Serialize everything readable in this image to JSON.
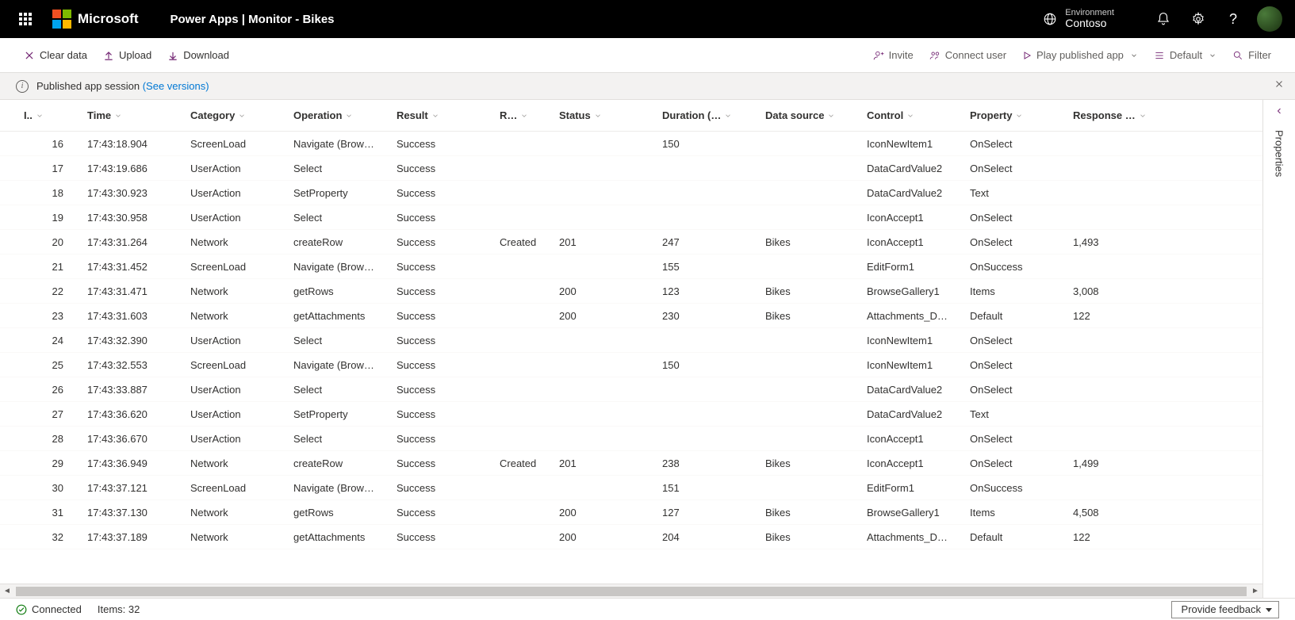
{
  "topbar": {
    "microsoft": "Microsoft",
    "app_title": "Power Apps  |  Monitor - Bikes",
    "env_label": "Environment",
    "env_name": "Contoso"
  },
  "cmdbar": {
    "clear": "Clear data",
    "upload": "Upload",
    "download": "Download",
    "invite": "Invite",
    "connect": "Connect user",
    "play": "Play published app",
    "default": "Default",
    "filter": "Filter"
  },
  "infobar": {
    "text": "Published app session",
    "link": "(See versions)"
  },
  "table": {
    "columns": {
      "id": "I..",
      "time": "Time",
      "category": "Category",
      "operation": "Operation",
      "result": "Result",
      "rstatus": "R…",
      "status": "Status",
      "duration": "Duration (…",
      "datasource": "Data source",
      "control": "Control",
      "property": "Property",
      "response": "Response …"
    },
    "rows": [
      {
        "id": "16",
        "time": "17:43:18.904",
        "category": "ScreenLoad",
        "operation": "Navigate (Brow…",
        "result": "Success",
        "rstatus": "",
        "status": "",
        "duration": "150",
        "datasource": "",
        "control": "IconNewItem1",
        "property": "OnSelect",
        "response": ""
      },
      {
        "id": "17",
        "time": "17:43:19.686",
        "category": "UserAction",
        "operation": "Select",
        "result": "Success",
        "rstatus": "",
        "status": "",
        "duration": "",
        "datasource": "",
        "control": "DataCardValue2",
        "property": "OnSelect",
        "response": ""
      },
      {
        "id": "18",
        "time": "17:43:30.923",
        "category": "UserAction",
        "operation": "SetProperty",
        "result": "Success",
        "rstatus": "",
        "status": "",
        "duration": "",
        "datasource": "",
        "control": "DataCardValue2",
        "property": "Text",
        "response": ""
      },
      {
        "id": "19",
        "time": "17:43:30.958",
        "category": "UserAction",
        "operation": "Select",
        "result": "Success",
        "rstatus": "",
        "status": "",
        "duration": "",
        "datasource": "",
        "control": "IconAccept1",
        "property": "OnSelect",
        "response": ""
      },
      {
        "id": "20",
        "time": "17:43:31.264",
        "category": "Network",
        "operation": "createRow",
        "result": "Success",
        "rstatus": "Created",
        "status": "201",
        "duration": "247",
        "datasource": "Bikes",
        "control": "IconAccept1",
        "property": "OnSelect",
        "response": "1,493"
      },
      {
        "id": "21",
        "time": "17:43:31.452",
        "category": "ScreenLoad",
        "operation": "Navigate (Brow…",
        "result": "Success",
        "rstatus": "",
        "status": "",
        "duration": "155",
        "datasource": "",
        "control": "EditForm1",
        "property": "OnSuccess",
        "response": ""
      },
      {
        "id": "22",
        "time": "17:43:31.471",
        "category": "Network",
        "operation": "getRows",
        "result": "Success",
        "rstatus": "",
        "status": "200",
        "duration": "123",
        "datasource": "Bikes",
        "control": "BrowseGallery1",
        "property": "Items",
        "response": "3,008"
      },
      {
        "id": "23",
        "time": "17:43:31.603",
        "category": "Network",
        "operation": "getAttachments",
        "result": "Success",
        "rstatus": "",
        "status": "200",
        "duration": "230",
        "datasource": "Bikes",
        "control": "Attachments_D…",
        "property": "Default",
        "response": "122"
      },
      {
        "id": "24",
        "time": "17:43:32.390",
        "category": "UserAction",
        "operation": "Select",
        "result": "Success",
        "rstatus": "",
        "status": "",
        "duration": "",
        "datasource": "",
        "control": "IconNewItem1",
        "property": "OnSelect",
        "response": ""
      },
      {
        "id": "25",
        "time": "17:43:32.553",
        "category": "ScreenLoad",
        "operation": "Navigate (Brow…",
        "result": "Success",
        "rstatus": "",
        "status": "",
        "duration": "150",
        "datasource": "",
        "control": "IconNewItem1",
        "property": "OnSelect",
        "response": ""
      },
      {
        "id": "26",
        "time": "17:43:33.887",
        "category": "UserAction",
        "operation": "Select",
        "result": "Success",
        "rstatus": "",
        "status": "",
        "duration": "",
        "datasource": "",
        "control": "DataCardValue2",
        "property": "OnSelect",
        "response": ""
      },
      {
        "id": "27",
        "time": "17:43:36.620",
        "category": "UserAction",
        "operation": "SetProperty",
        "result": "Success",
        "rstatus": "",
        "status": "",
        "duration": "",
        "datasource": "",
        "control": "DataCardValue2",
        "property": "Text",
        "response": ""
      },
      {
        "id": "28",
        "time": "17:43:36.670",
        "category": "UserAction",
        "operation": "Select",
        "result": "Success",
        "rstatus": "",
        "status": "",
        "duration": "",
        "datasource": "",
        "control": "IconAccept1",
        "property": "OnSelect",
        "response": ""
      },
      {
        "id": "29",
        "time": "17:43:36.949",
        "category": "Network",
        "operation": "createRow",
        "result": "Success",
        "rstatus": "Created",
        "status": "201",
        "duration": "238",
        "datasource": "Bikes",
        "control": "IconAccept1",
        "property": "OnSelect",
        "response": "1,499"
      },
      {
        "id": "30",
        "time": "17:43:37.121",
        "category": "ScreenLoad",
        "operation": "Navigate (Brow…",
        "result": "Success",
        "rstatus": "",
        "status": "",
        "duration": "151",
        "datasource": "",
        "control": "EditForm1",
        "property": "OnSuccess",
        "response": ""
      },
      {
        "id": "31",
        "time": "17:43:37.130",
        "category": "Network",
        "operation": "getRows",
        "result": "Success",
        "rstatus": "",
        "status": "200",
        "duration": "127",
        "datasource": "Bikes",
        "control": "BrowseGallery1",
        "property": "Items",
        "response": "4,508"
      },
      {
        "id": "32",
        "time": "17:43:37.189",
        "category": "Network",
        "operation": "getAttachments",
        "result": "Success",
        "rstatus": "",
        "status": "200",
        "duration": "204",
        "datasource": "Bikes",
        "control": "Attachments_D…",
        "property": "Default",
        "response": "122"
      }
    ]
  },
  "properties_panel": {
    "label": "Properties"
  },
  "statusbar": {
    "connected": "Connected",
    "items": "Items: 32",
    "feedback": "Provide feedback"
  }
}
